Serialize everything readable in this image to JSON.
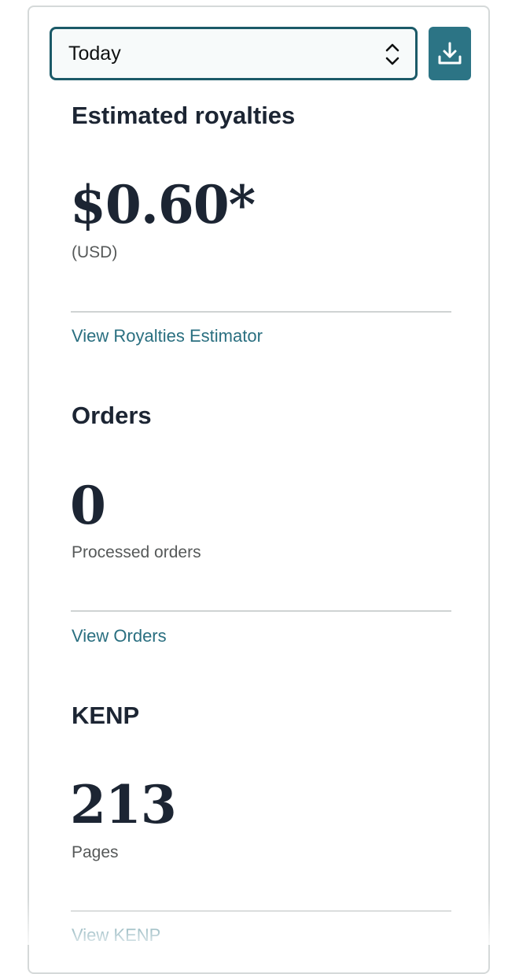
{
  "range_select": {
    "value": "Today",
    "icon": "chevron-up-down-icon"
  },
  "download": {
    "icon": "download-icon",
    "color": "#2c7485"
  },
  "royalties": {
    "title": "Estimated royalties",
    "value": "$0.60*",
    "caption": "(USD)",
    "link": "View Royalties Estimator"
  },
  "orders": {
    "title": "Orders",
    "value": "0",
    "caption": "Processed orders",
    "link": "View Orders"
  },
  "kenp": {
    "title": "KENP",
    "value": "213",
    "caption": "Pages",
    "link": "View KENP"
  },
  "colors": {
    "accent": "#2c7485",
    "link": "#2a6f80",
    "heading": "#1c2533"
  }
}
